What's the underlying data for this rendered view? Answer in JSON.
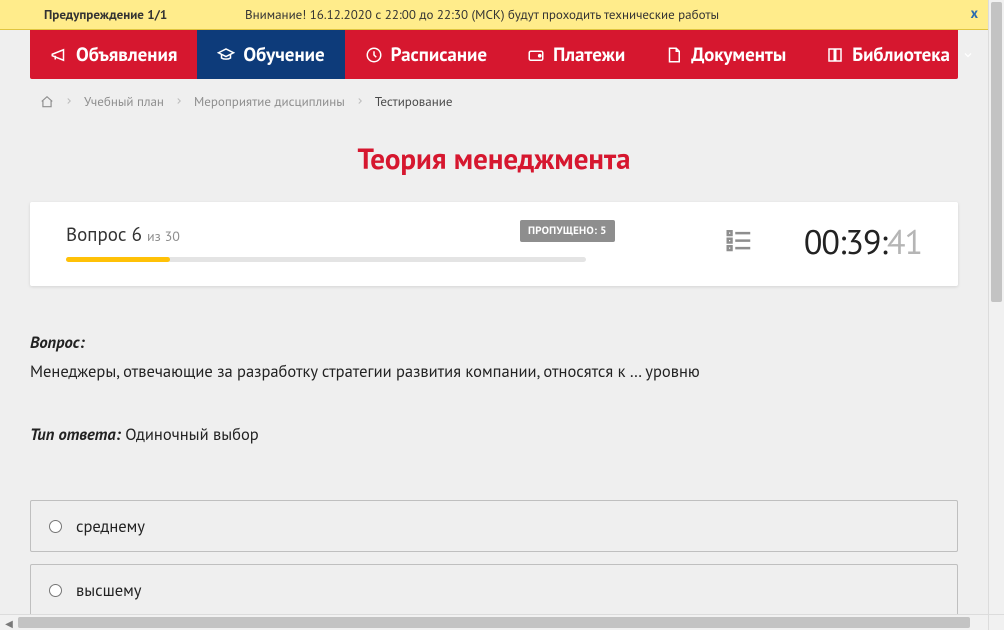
{
  "warning": {
    "title": "Предупреждение 1/1",
    "message": "Внимание! 16.12.2020 с 22:00 до 22:30 (МСК) будут проходить технические работы",
    "close": "x"
  },
  "nav": {
    "items": [
      {
        "icon": "megaphone-icon",
        "label": "Объявления",
        "active": false,
        "chevron": false
      },
      {
        "icon": "grad-cap-icon",
        "label": "Обучение",
        "active": true,
        "chevron": false
      },
      {
        "icon": "clock-icon",
        "label": "Расписание",
        "active": false,
        "chevron": false
      },
      {
        "icon": "wallet-icon",
        "label": "Платежи",
        "active": false,
        "chevron": false
      },
      {
        "icon": "doc-icon",
        "label": "Документы",
        "active": false,
        "chevron": false
      },
      {
        "icon": "book-icon",
        "label": "Библиотека",
        "active": false,
        "chevron": true
      }
    ]
  },
  "breadcrumbs": {
    "items": [
      {
        "label": "Учебный план"
      },
      {
        "label": "Мероприятие дисциплины"
      }
    ],
    "current": "Тестирование"
  },
  "page_title": "Теория менеджмента",
  "question_header": {
    "label": "Вопрос",
    "number": "6",
    "of_prefix": "из",
    "total": "30",
    "skipped_label": "ПРОПУЩЕНО:",
    "skipped_count": "5",
    "progress_percent": 20
  },
  "timer": {
    "mm": "00",
    "ss": "39",
    "ms": "41"
  },
  "question": {
    "label": "Вопрос:",
    "text": "Менеджеры, отвечающие за разработку стратегии развития компании, относятся к … уровню"
  },
  "answer_type": {
    "label": "Тип ответа:",
    "value": "Одиночный выбор"
  },
  "options": [
    {
      "text": "среднему"
    },
    {
      "text": "высшему"
    }
  ]
}
